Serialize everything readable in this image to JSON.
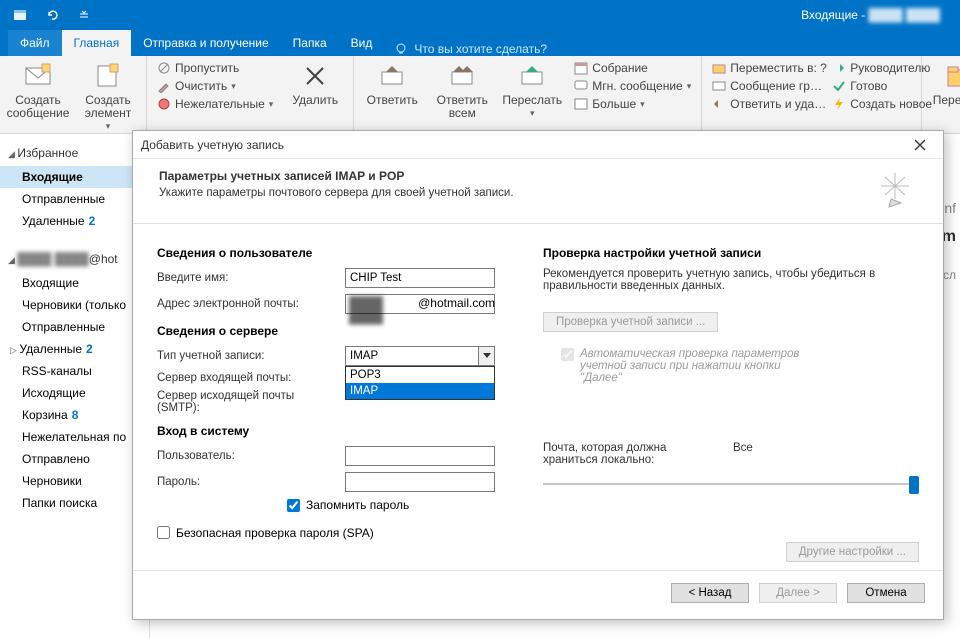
{
  "titlebar": {
    "window_title_prefix": "Входящие - ",
    "window_title_blur": "████ ████"
  },
  "tabs": {
    "file": "Файл",
    "home": "Главная",
    "send_recv": "Отправка и получение",
    "folder": "Папка",
    "view": "Вид",
    "tell_me": "Что вы хотите сделать?"
  },
  "ribbon": {
    "new_mail": "Создать сообщение",
    "new_item": "Создать элемент",
    "ignore": "Пропустить",
    "clean": "Очистить",
    "junk": "Нежелательные",
    "delete": "Удалить",
    "reply": "Ответить",
    "reply_all": "Ответить всем",
    "forward": "Переслать",
    "meeting": "Собрание",
    "im": "Мгн. сообщение",
    "more": "Больше",
    "move_to": "Переместить в: ?",
    "team_mail": "Сообщение гр…",
    "reply_del": "Ответить и уда…",
    "to_manager": "Руководителю",
    "done": "Готово",
    "create_new": "Создать новое",
    "move": "Перемест"
  },
  "nav": {
    "favorites": "Избранное",
    "inbox": "Входящие",
    "sent": "Отправленные",
    "deleted": "Удаленные",
    "deleted_count": "2",
    "account_blur": "████ ████",
    "account_suffix": "@hot",
    "inbox2": "Входящие",
    "drafts": "Черновики (только",
    "sent2": "Отправленные",
    "deleted2": "Удаленные",
    "deleted2_count": "2",
    "rss": "RSS-каналы",
    "outbox": "Исходящие",
    "trash": "Корзина",
    "trash_count": "8",
    "junk": "Нежелательная по",
    "sent3": "Отправлено",
    "drafts2": "Черновики",
    "search_folders": "Папки поиска"
  },
  "dialog": {
    "title": "Добавить учетную запись",
    "header_title": "Параметры учетных записей IMAP и POP",
    "header_sub": "Укажите параметры почтового сервера для своей учетной записи.",
    "user_info": "Сведения о пользователе",
    "name_label": "Введите имя:",
    "name_value": "CHIP Test",
    "email_label": "Адрес электронной почты:",
    "email_blur": "████ ████",
    "email_suffix": "@hotmail.com",
    "server_info": "Сведения о сервере",
    "acct_type_label": "Тип учетной записи:",
    "acct_type_value": "IMAP",
    "acct_type_options": [
      "POP3",
      "IMAP"
    ],
    "incoming_label": "Сервер входящей почты:",
    "outgoing_label": "Сервер исходящей почты (SMTP):",
    "login_info": "Вход в систему",
    "user_label": "Пользователь:",
    "pass_label": "Пароль:",
    "remember": "Запомнить пароль",
    "spa": "Безопасная проверка пароля (SPA)",
    "test_heading": "Проверка настройки учетной записи",
    "test_text": "Рекомендуется проверить учетную запись, чтобы убедиться в правильности введенных данных.",
    "test_btn": "Проверка учетной записи ...",
    "auto_test": "Автоматическая проверка параметров учетной записи при нажатии кнопки \"Далее\"",
    "slider_label": "Почта, которая должна храниться локально:",
    "slider_value": "Все",
    "more_settings": "Другие настройки ...",
    "back": "< Назад",
    "next": "Далее >",
    "cancel": "Отмена"
  }
}
